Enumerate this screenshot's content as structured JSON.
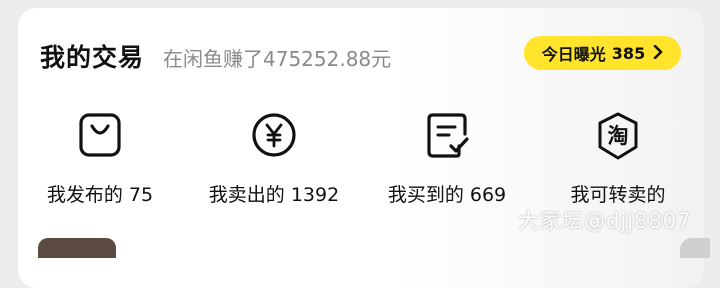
{
  "header": {
    "title": "我的交易",
    "subtitle": "在闲鱼赚了475252.88元",
    "exposure_label": "今日曝光",
    "exposure_count": "385"
  },
  "items": [
    {
      "label": "我发布的 75",
      "icon": "bag-icon"
    },
    {
      "label": "我卖出的 1392",
      "icon": "yen-icon"
    },
    {
      "label": "我买到的 669",
      "icon": "receipt-check-icon"
    },
    {
      "label": "我可转卖的",
      "icon": "taobao-icon",
      "icon_text": "淘"
    }
  ],
  "watermark": "大家坛@djj8807"
}
